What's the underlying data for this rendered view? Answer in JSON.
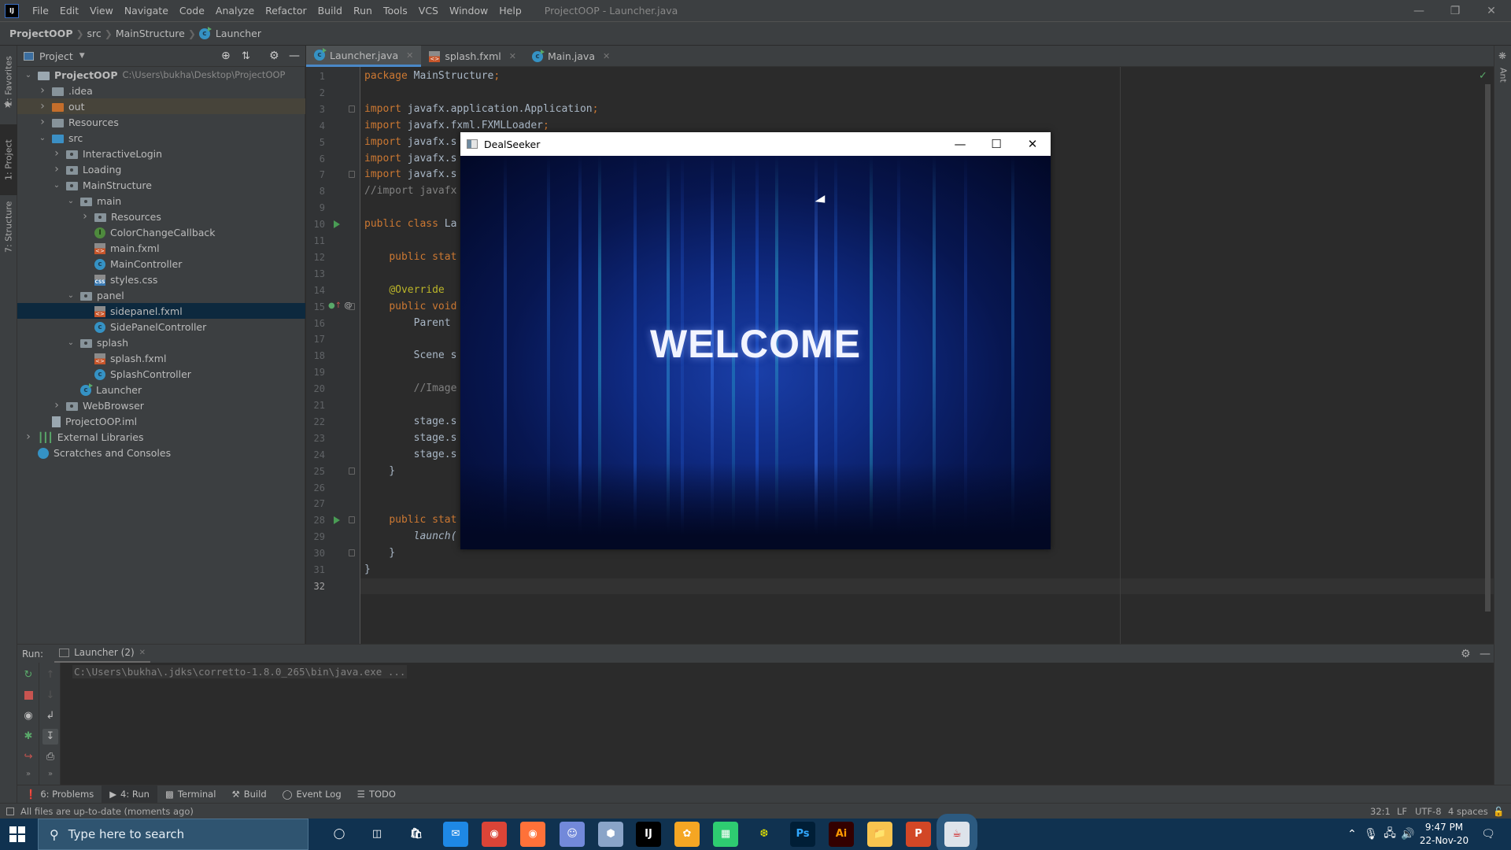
{
  "ide": {
    "menu": [
      "File",
      "Edit",
      "View",
      "Navigate",
      "Code",
      "Analyze",
      "Refactor",
      "Build",
      "Run",
      "Tools",
      "VCS",
      "Window",
      "Help"
    ],
    "window_title": "ProjectOOP - Launcher.java",
    "breadcrumb": [
      "ProjectOOP",
      "src",
      "MainStructure",
      "Launcher"
    ],
    "run_config": "Launcher (2)",
    "toolbar_icons": [
      "build-hammer-icon",
      "rerun-icon",
      "debug-icon",
      "coverage-icon",
      "stop-icon",
      "project-structure-icon",
      "terminal-frame-icon",
      "search-icon"
    ],
    "left_stripe": [
      "2: Favorites",
      "1: Project",
      "7: Structure"
    ],
    "right_stripe": [
      "Ant"
    ],
    "project_panel": {
      "title": "Project",
      "tree": [
        {
          "label": "ProjectOOP",
          "extra": "C:\\Users\\bukha\\Desktop\\ProjectOOP",
          "depth": 0,
          "expanded": true,
          "icon": "module"
        },
        {
          "label": ".idea",
          "depth": 1,
          "expanded": false,
          "icon": "folder"
        },
        {
          "label": "out",
          "depth": 1,
          "expanded": false,
          "icon": "folder-out"
        },
        {
          "label": "Resources",
          "depth": 1,
          "expanded": false,
          "icon": "folder"
        },
        {
          "label": "src",
          "depth": 1,
          "expanded": true,
          "icon": "folder-src"
        },
        {
          "label": "InteractiveLogin",
          "depth": 2,
          "expanded": false,
          "icon": "package"
        },
        {
          "label": "Loading",
          "depth": 2,
          "expanded": false,
          "icon": "package"
        },
        {
          "label": "MainStructure",
          "depth": 2,
          "expanded": true,
          "icon": "package"
        },
        {
          "label": "main",
          "depth": 3,
          "expanded": true,
          "icon": "package"
        },
        {
          "label": "Resources",
          "depth": 4,
          "expanded": false,
          "icon": "package"
        },
        {
          "label": "ColorChangeCallback",
          "depth": 4,
          "icon": "interface"
        },
        {
          "label": "main.fxml",
          "depth": 4,
          "icon": "fxml"
        },
        {
          "label": "MainController",
          "depth": 4,
          "icon": "class"
        },
        {
          "label": "styles.css",
          "depth": 4,
          "icon": "css"
        },
        {
          "label": "panel",
          "depth": 3,
          "expanded": true,
          "icon": "package"
        },
        {
          "label": "sidepanel.fxml",
          "depth": 4,
          "icon": "fxml",
          "selected": true
        },
        {
          "label": "SidePanelController",
          "depth": 4,
          "icon": "class"
        },
        {
          "label": "splash",
          "depth": 3,
          "expanded": true,
          "icon": "package"
        },
        {
          "label": "splash.fxml",
          "depth": 4,
          "icon": "fxml"
        },
        {
          "label": "SplashController",
          "depth": 4,
          "icon": "class"
        },
        {
          "label": "Launcher",
          "depth": 3,
          "icon": "class-run"
        },
        {
          "label": "WebBrowser",
          "depth": 2,
          "expanded": false,
          "icon": "package"
        },
        {
          "label": "ProjectOOP.iml",
          "depth": 1,
          "icon": "iml"
        },
        {
          "label": "External Libraries",
          "depth": 0,
          "expanded": false,
          "icon": "libraries"
        },
        {
          "label": "Scratches and Consoles",
          "depth": 0,
          "icon": "scratches"
        }
      ]
    },
    "editor_tabs": [
      {
        "label": "Launcher.java",
        "icon": "class-run",
        "active": true
      },
      {
        "label": "splash.fxml",
        "icon": "fxml",
        "active": false
      },
      {
        "label": "Main.java",
        "icon": "class-run",
        "active": false
      }
    ],
    "code_lines": [
      [
        [
          "kw",
          "package "
        ],
        [
          "t",
          "MainStructure"
        ],
        [
          "kw",
          ";"
        ]
      ],
      [],
      [
        [
          "kw",
          "import "
        ],
        [
          "t",
          "javafx.application.Application"
        ],
        [
          "kw",
          ";"
        ]
      ],
      [
        [
          "kw",
          "import "
        ],
        [
          "t",
          "javafx.fxml.FXMLLoader"
        ],
        [
          "kw",
          ";"
        ]
      ],
      [
        [
          "kw",
          "import "
        ],
        [
          "t",
          "javafx.s"
        ]
      ],
      [
        [
          "kw",
          "import "
        ],
        [
          "t",
          "javafx.s"
        ]
      ],
      [
        [
          "kw",
          "import "
        ],
        [
          "t",
          "javafx.s"
        ]
      ],
      [
        [
          "cm",
          "//import javafx"
        ]
      ],
      [],
      [
        [
          "kw",
          "public class "
        ],
        [
          "t",
          "La"
        ]
      ],
      [],
      [
        [
          "t",
          "    "
        ],
        [
          "kw",
          "public stat"
        ]
      ],
      [],
      [
        [
          "t",
          "    "
        ],
        [
          "an",
          "@Override"
        ]
      ],
      [
        [
          "t",
          "    "
        ],
        [
          "kw",
          "public void"
        ]
      ],
      [
        [
          "t",
          "        Parent "
        ]
      ],
      [],
      [
        [
          "t",
          "        Scene s"
        ]
      ],
      [],
      [
        [
          "t",
          "        "
        ],
        [
          "cm",
          "//Image"
        ]
      ],
      [],
      [
        [
          "t",
          "        stage.s"
        ]
      ],
      [
        [
          "t",
          "        stage.s"
        ]
      ],
      [
        [
          "t",
          "        stage.s"
        ]
      ],
      [
        [
          "t",
          "    }"
        ]
      ],
      [],
      [],
      [
        [
          "t",
          "    "
        ],
        [
          "kw",
          "public stat"
        ]
      ],
      [
        [
          "t",
          "        "
        ],
        [
          "it",
          "launch("
        ]
      ],
      [
        [
          "t",
          "    }"
        ]
      ],
      [
        [
          "t",
          "}"
        ]
      ],
      []
    ],
    "current_line": 32,
    "run_panel": {
      "label": "Run:",
      "tab": "Launcher (2)",
      "console": "C:\\Users\\bukha\\.jdks\\corretto-1.8.0_265\\bin\\java.exe ..."
    },
    "bottom_tabs": [
      {
        "label": "6: Problems",
        "icon": "problems-icon"
      },
      {
        "label": "4: Run",
        "icon": "run-icon",
        "active": true
      },
      {
        "label": "Terminal",
        "icon": "terminal-icon"
      },
      {
        "label": "Build",
        "icon": "build-icon"
      },
      {
        "label": "Event Log",
        "icon": "event-log-icon"
      },
      {
        "label": "TODO",
        "icon": "todo-icon"
      }
    ],
    "status": {
      "message": "All files are up-to-date (moments ago)",
      "position": "32:1",
      "line_sep": "LF",
      "encoding": "UTF-8",
      "indent": "4 spaces"
    }
  },
  "app_window": {
    "title": "DealSeeker",
    "welcome_text": "WELCOME"
  },
  "taskbar": {
    "search_placeholder": "Type here to search",
    "apps": [
      "cortana",
      "task-view",
      "microsoft-store",
      "mail",
      "chrome",
      "firefox",
      "discord",
      "virtualbox",
      "intellij-idea",
      "app-orange",
      "app-green",
      "scene-builder",
      "photoshop",
      "illustrator",
      "file-explorer",
      "powerpoint",
      "java-app"
    ],
    "time": "9:47 PM",
    "date": "22-Nov-20"
  },
  "colors": {
    "keyword": "#cc7832",
    "annotation": "#bbb529",
    "comment": "#808080",
    "selection": "#0d293e",
    "accent": "#4a88c7"
  }
}
